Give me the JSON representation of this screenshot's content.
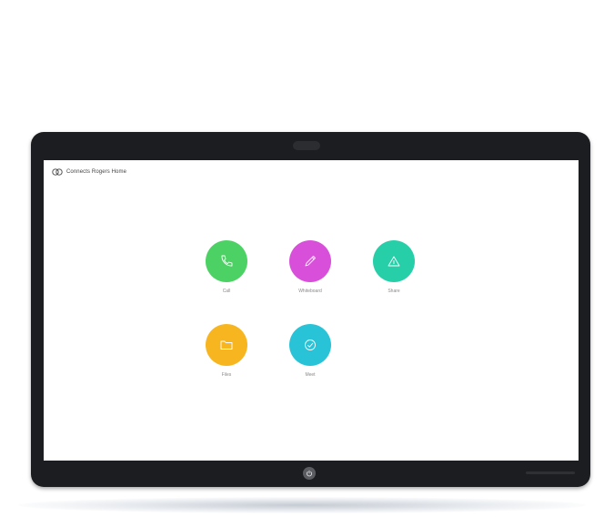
{
  "screen": {
    "brand": {
      "icon": "webex-logo-icon",
      "text": "Connects Rogers Home"
    },
    "apps": [
      {
        "label": "Call",
        "icon": "phone-icon",
        "color": "#4cd264"
      },
      {
        "label": "Whiteboard",
        "icon": "pen-icon",
        "color": "#d84fd9"
      },
      {
        "label": "Share",
        "icon": "share-icon",
        "color": "#27cfa8"
      },
      {
        "label": "Files",
        "icon": "folder-icon",
        "color": "#f7b520"
      },
      {
        "label": "Meet",
        "icon": "meet-icon",
        "color": "#29c3d8"
      }
    ]
  },
  "device": {
    "home_button_icon": "power-icon",
    "bezel_color": "#1c1d20"
  }
}
